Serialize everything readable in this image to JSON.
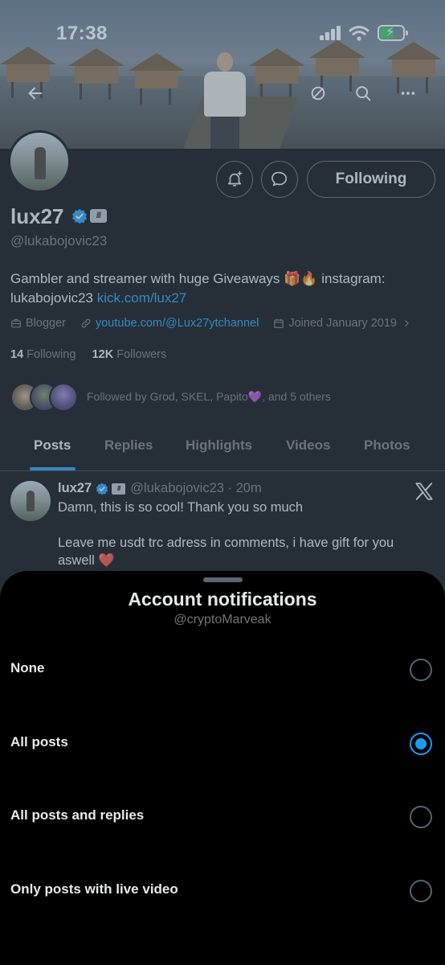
{
  "status_bar": {
    "time": "17:38"
  },
  "icons": {
    "back": "arrow-left-icon",
    "hide": "eye-slash-icon",
    "search": "search-icon",
    "more": "more-dots-icon",
    "notify": "bell-plus-icon",
    "message": "message-bubble-icon",
    "x_logo": "x-logo-icon"
  },
  "profile": {
    "follow_button": "Following",
    "name": "lux27",
    "handle": "@lukabojovic23",
    "bio_text": "Gambler and streamer with huge Giveaways 🎁🔥 instagram: lukabojovic23 ",
    "bio_link": "kick.com/lux27",
    "category": "Blogger",
    "website": "youtube.com/@Lux27ytchannel",
    "joined": "Joined January 2019",
    "following_count": "14",
    "following_label": "Following",
    "followers_count": "12K",
    "followers_label": "Followers",
    "followed_by": "Followed by Grod, SKEL, Papito💜, and 5 others"
  },
  "tabs": [
    "Posts",
    "Replies",
    "Highlights",
    "Videos",
    "Photos"
  ],
  "post": {
    "name": "lux27",
    "handle_time": "@lukabojovic23 · 20m",
    "text": "Damn, this is so cool! Thank you so much\n\nLeave me usdt trc adress in comments, i have gift for you aswell ❤️"
  },
  "sheet": {
    "title": "Account notifications",
    "subtitle": "@cryptoMarveak",
    "options": [
      {
        "label": "None",
        "selected": false
      },
      {
        "label": "All posts",
        "selected": true
      },
      {
        "label": "All posts and replies",
        "selected": false
      },
      {
        "label": "Only posts with live video",
        "selected": false
      }
    ]
  },
  "colors": {
    "accent": "#1d9bf0",
    "background": "#000000",
    "text_primary": "#e7e9ea",
    "text_secondary": "#71767b",
    "battery": "#34c759"
  }
}
